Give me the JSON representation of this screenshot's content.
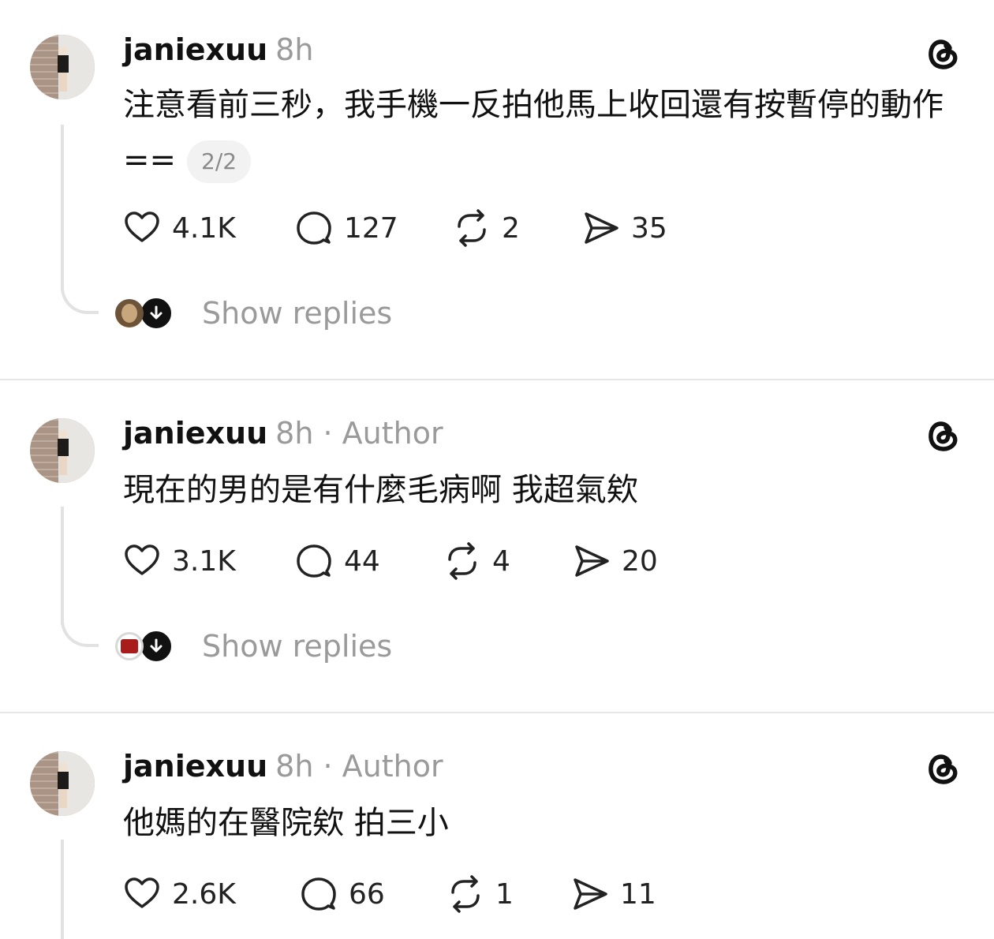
{
  "posts": [
    {
      "username": "janiexuu",
      "time": "8h",
      "author": "",
      "text": "注意看前三秒，我手機一反拍他馬上收回還有按暫停的動作==",
      "page_indicator": "2/2",
      "likes": "4.1K",
      "comments": "127",
      "reposts": "2",
      "shares": "35",
      "show_replies": "Show replies"
    },
    {
      "username": "janiexuu",
      "time": "8h",
      "author": "· Author",
      "text": "現在的男的是有什麼毛病啊 我超氣欸",
      "likes": "3.1K",
      "comments": "44",
      "reposts": "4",
      "shares": "20",
      "show_replies": "Show replies"
    },
    {
      "username": "janiexuu",
      "time": "8h",
      "author": "· Author",
      "text": "他媽的在醫院欸 拍三小",
      "likes": "2.6K",
      "comments": "66",
      "reposts": "1",
      "shares": "11"
    }
  ],
  "icons": {
    "like": "heart-icon",
    "comment": "comment-bubble-icon",
    "repost": "repost-icon",
    "share": "send-icon",
    "app": "threads-logo-icon",
    "expand": "arrow-down-icon"
  },
  "colors": {
    "text": "#111111",
    "muted": "#9a9a9a",
    "divider": "#e6e6e6"
  }
}
